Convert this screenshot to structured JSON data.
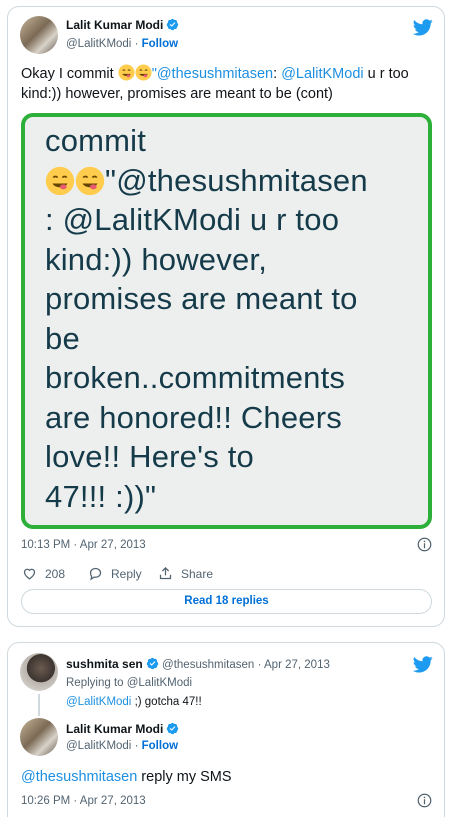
{
  "tweet1": {
    "author_name": "Lalit Kumar Modi",
    "author_handle": "@LalitKModi",
    "follow_label": "Follow",
    "separator": "·",
    "text_part1": "Okay I commit ",
    "mention1": "\"@thesushmitasen",
    "text_part2": ": ",
    "mention2": "@LalitKModi",
    "text_part3": " u r too kind:)) however, promises are meant to be (cont)",
    "image_text": {
      "line1": "commit",
      "line2_mention": "\"@thesushmitasen",
      "line3": ": @LalitKModi u r too",
      "line4": "kind:)) however,",
      "line5": "promises are meant to",
      "line6": "be",
      "line7": "broken..commitments",
      "line8": "are honored!! Cheers",
      "line9": "love!! Here's to",
      "line10": "47!!! :))\""
    },
    "timestamp": "10:13 PM · Apr 27, 2013",
    "likes_count": "208",
    "reply_label": "Reply",
    "share_label": "Share",
    "read_replies_label": "Read 18 replies"
  },
  "tweet2": {
    "author_name": "sushmita sen",
    "author_handle": "@thesushmitasen",
    "date": "· Apr 27, 2013",
    "replying_to": "Replying to @LalitKModi",
    "reply_mention": "@LalitKModi",
    "reply_text": " ;) gotcha 47!!"
  },
  "tweet3": {
    "author_name": "Lalit Kumar Modi",
    "author_handle": "@LalitKModi",
    "follow_label": "Follow",
    "separator": "·",
    "mention": "@thesushmitasen",
    "text": " reply my SMS",
    "timestamp": "10:26 PM · Apr 27, 2013"
  },
  "colors": {
    "twitter_blue": "#1d9bf0",
    "link_blue": "#1d8fe0",
    "image_border_green": "#2db039",
    "image_text": "#153a4a"
  },
  "icons": [
    "verified-badge-icon",
    "twitter-bird-icon",
    "smiling-face-emoji",
    "info-icon",
    "heart-icon",
    "reply-bubble-icon",
    "share-icon"
  ]
}
